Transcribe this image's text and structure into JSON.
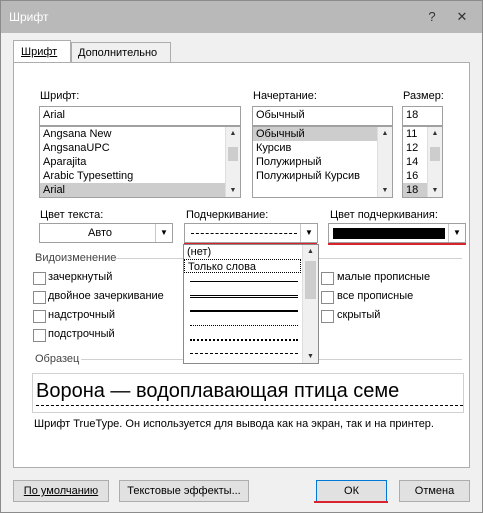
{
  "window": {
    "title": "Шрифт",
    "help_glyph": "?",
    "close_glyph": "✕"
  },
  "tabs": [
    {
      "label": "Шрифт"
    },
    {
      "label": "Дополнительно"
    }
  ],
  "font": {
    "label": "Шрифт:",
    "value": "Arial",
    "items": [
      "Angsana New",
      "AngsanaUPC",
      "Aparajita",
      "Arabic Typesetting",
      "Arial"
    ]
  },
  "style": {
    "label": "Начертание:",
    "value": "Обычный",
    "items": [
      "Обычный",
      "Курсив",
      "Полужирный",
      "Полужирный Курсив"
    ]
  },
  "size": {
    "label": "Размер:",
    "value": "18",
    "items": [
      "11",
      "12",
      "14",
      "16",
      "18"
    ]
  },
  "text_color": {
    "label": "Цвет текста:",
    "value": "Авто"
  },
  "underline": {
    "label": "Подчеркивание:",
    "options": [
      "(нет)",
      "Только слова"
    ]
  },
  "underline_color": {
    "label": "Цвет подчеркивания:",
    "swatch": "#000000"
  },
  "effects": {
    "label": "Видоизменение",
    "left": [
      "зачеркнутый",
      "двойное зачеркивание",
      "надстрочный",
      "подстрочный"
    ],
    "right": [
      "малые прописные",
      "все прописные",
      "скрытый"
    ]
  },
  "preview": {
    "label": "Образец",
    "text": "Ворона — водоплавающая птица семе",
    "note": "Шрифт TrueType. Он используется для вывода как на экран, так и на принтер."
  },
  "buttons": {
    "default": "По умолчанию",
    "effects": "Текстовые эффекты...",
    "ok": "ОК",
    "cancel": "Отмена"
  },
  "colors": {
    "highlight_red": "#d9232d",
    "selection": "#cdcdcd"
  }
}
